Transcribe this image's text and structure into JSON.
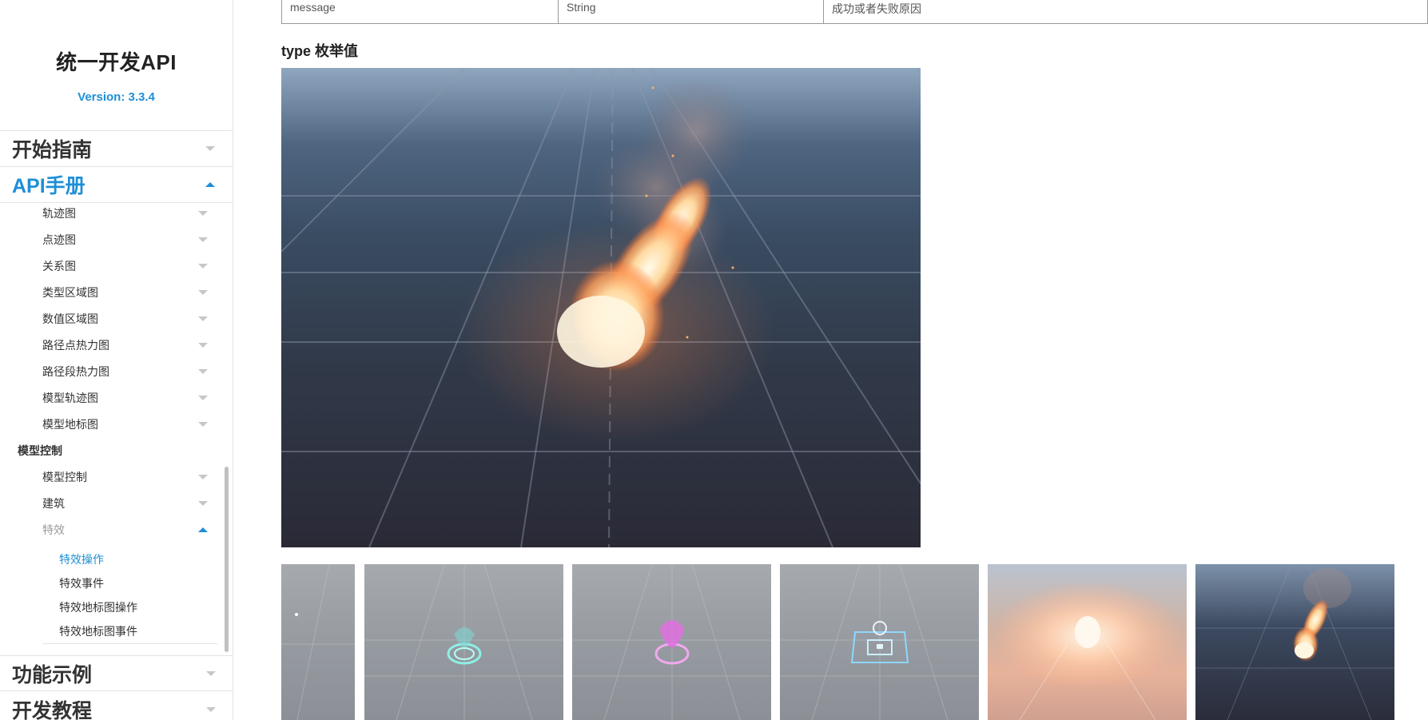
{
  "brand": {
    "title": "统一开发API",
    "version": "Version: 3.3.4"
  },
  "nav": {
    "getting_started": "开始指南",
    "api_manual": "API手册",
    "examples": "功能示例",
    "tutorials": "开发教程"
  },
  "sidebar": {
    "charts": [
      "轨迹图",
      "点迹图",
      "关系图",
      "类型区域图",
      "数值区域图",
      "路径点热力图",
      "路径段热力图",
      "模型轨迹图",
      "模型地标图"
    ],
    "model_section": "模型控制",
    "model_items": [
      "模型控制",
      "建筑",
      "特效"
    ],
    "effect_leaves": [
      "特效操作",
      "特效事件",
      "特效地标图操作",
      "特效地标图事件"
    ]
  },
  "table": {
    "row": [
      "message",
      "String",
      "成功或者失败原因"
    ]
  },
  "content": {
    "section_title": "type 枚举值"
  },
  "colors": {
    "accent": "#1e8fd6",
    "text": "#333333",
    "muted": "#999999",
    "border": "#e3e3e3"
  }
}
